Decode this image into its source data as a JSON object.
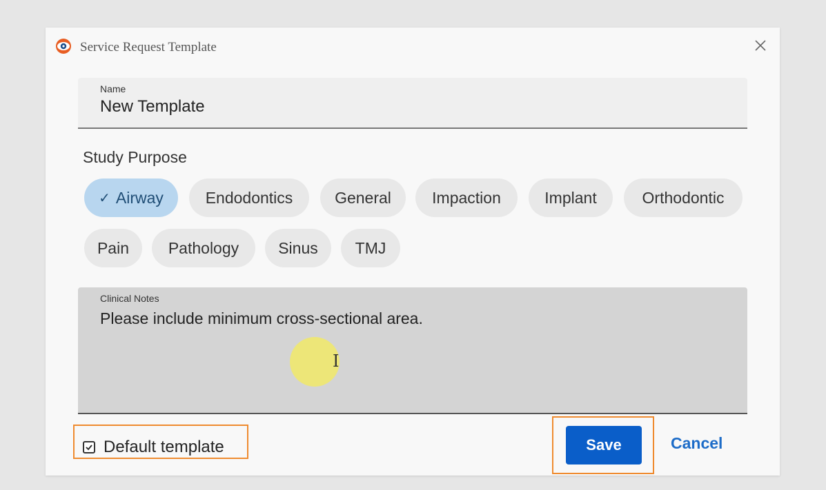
{
  "window": {
    "title": "Service Request Template",
    "close_icon": "close-icon",
    "app_icon": "eye-logo-icon"
  },
  "name_field": {
    "label": "Name",
    "value": "New Template"
  },
  "study_purpose": {
    "label": "Study Purpose",
    "chips": [
      {
        "label": "Airway",
        "selected": true
      },
      {
        "label": "Endodontics",
        "selected": false
      },
      {
        "label": "General",
        "selected": false
      },
      {
        "label": "Impaction",
        "selected": false
      },
      {
        "label": "Implant",
        "selected": false
      },
      {
        "label": "Orthodontic",
        "selected": false
      },
      {
        "label": "Pain",
        "selected": false
      },
      {
        "label": "Pathology",
        "selected": false
      },
      {
        "label": "Sinus",
        "selected": false
      },
      {
        "label": "TMJ",
        "selected": false
      }
    ]
  },
  "clinical_notes": {
    "label": "Clinical Notes",
    "value": "Please include minimum cross-sectional area."
  },
  "footer": {
    "default_template_label": "Default template",
    "default_template_checked": true,
    "save_label": "Save",
    "cancel_label": "Cancel"
  },
  "colors": {
    "accent": "#0a5ec9",
    "link": "#1d6cc8",
    "chip_selected": "#b8d6ef",
    "highlight": "#ef8a2e"
  }
}
